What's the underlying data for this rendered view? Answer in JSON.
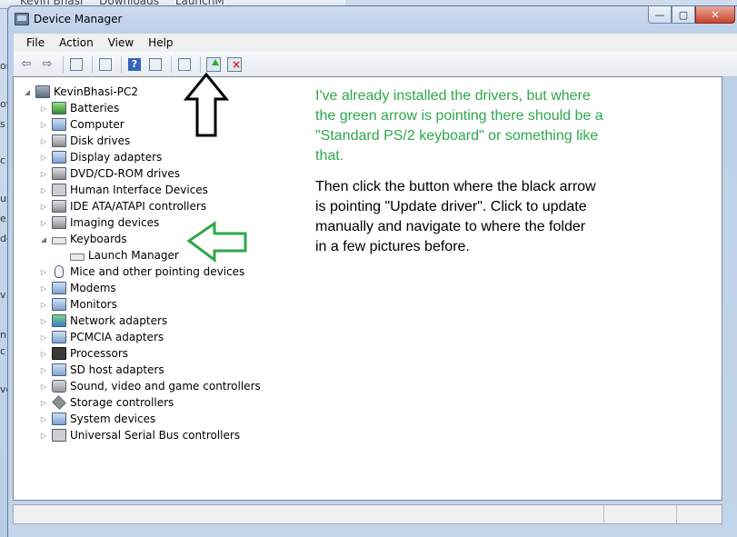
{
  "background": {
    "breadcrumbs": [
      "Kevin Bhasi",
      "Downloads",
      "LaunchM"
    ],
    "left_edge_letters": [
      "or",
      "ov",
      "s",
      "c",
      "us",
      "e",
      "de",
      "v",
      "np",
      "c",
      "ve"
    ]
  },
  "window": {
    "title": "Device Manager",
    "caption": {
      "minimize": "—",
      "maximize": "▢",
      "close": "✕"
    }
  },
  "menu": {
    "items": [
      "File",
      "Action",
      "View",
      "Help"
    ]
  },
  "toolbar": {
    "back": "⇦",
    "forward": "⇨",
    "help": "?"
  },
  "tree": {
    "root": "KevinBhasi-PC2",
    "categories": [
      {
        "label": "Batteries",
        "icon": "battery"
      },
      {
        "label": "Computer",
        "icon": "computer"
      },
      {
        "label": "Disk drives",
        "icon": "disk"
      },
      {
        "label": "Display adapters",
        "icon": "display"
      },
      {
        "label": "DVD/CD-ROM drives",
        "icon": "disk"
      },
      {
        "label": "Human Interface Devices",
        "icon": "hid"
      },
      {
        "label": "IDE ATA/ATAPI controllers",
        "icon": "ide"
      },
      {
        "label": "Imaging devices",
        "icon": "camera"
      },
      {
        "label": "Keyboards",
        "icon": "keyboard",
        "expanded": true,
        "children": [
          "Launch Manager"
        ]
      },
      {
        "label": "Mice and other pointing devices",
        "icon": "mouse"
      },
      {
        "label": "Modems",
        "icon": "modem"
      },
      {
        "label": "Monitors",
        "icon": "monitor"
      },
      {
        "label": "Network adapters",
        "icon": "network"
      },
      {
        "label": "PCMCIA adapters",
        "icon": "pcmcia"
      },
      {
        "label": "Processors",
        "icon": "chip"
      },
      {
        "label": "SD host adapters",
        "icon": "sd"
      },
      {
        "label": "Sound, video and game controllers",
        "icon": "sound"
      },
      {
        "label": "Storage controllers",
        "icon": "storage"
      },
      {
        "label": "System devices",
        "icon": "system"
      },
      {
        "label": "Universal Serial Bus controllers",
        "icon": "usb"
      }
    ]
  },
  "annotations": {
    "green_text": "I've already installed the drivers, but where the green arrow is pointing there should be a \"Standard PS/2 keyboard\" or something like that.",
    "black_text": "Then click the button where the black arrow is pointing \"Update driver\". Click to update manually and navigate to where the folder in a few pictures before.",
    "green_arrow_color": "#2ea84a",
    "black_arrow_color": "#000000"
  }
}
